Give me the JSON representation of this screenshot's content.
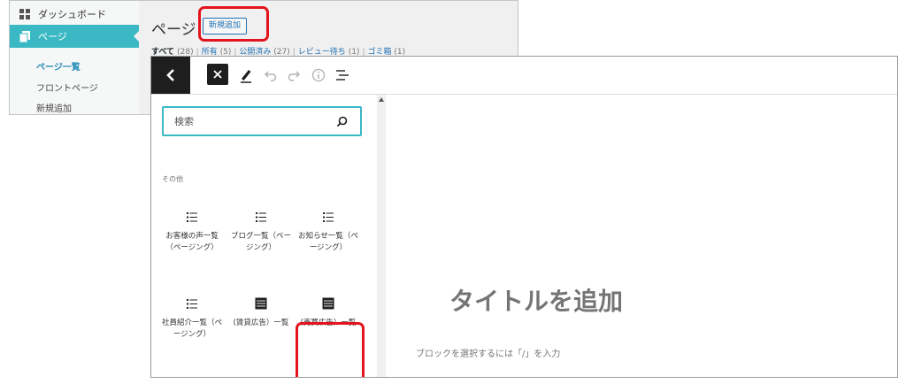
{
  "admin": {
    "sidebar": {
      "dashboard_label": "ダッシュボード",
      "pages_label": "ページ",
      "subitems": [
        "ページ一覧",
        "フロントページ",
        "新規追加"
      ]
    },
    "heading": "ページ",
    "new_button": "新規追加",
    "status": {
      "all": "すべて",
      "all_count": "(28)",
      "owned": "所有",
      "owned_count": "(5)",
      "published": "公開済み",
      "published_count": "(27)",
      "pending": "レビュー待ち",
      "pending_count": "(1)",
      "trash": "ゴミ箱",
      "trash_count": "(1)"
    }
  },
  "editor": {
    "toolbar_icons": [
      "chevron-left-icon",
      "close-icon",
      "pencil-icon",
      "undo-icon",
      "redo-icon",
      "info-icon",
      "list-view-icon"
    ],
    "search": {
      "placeholder": "検索",
      "value": ""
    },
    "category": "その他",
    "blocks": [
      {
        "label": "お客様の声一覧（ページング）",
        "icon": "list-icon"
      },
      {
        "label": "ブログ一覧（ページング）",
        "icon": "list-icon"
      },
      {
        "label": "お知らせ一覧（ページング）",
        "icon": "list-icon"
      },
      {
        "label": "社員紹介一覧（ページング）",
        "icon": "list-icon"
      },
      {
        "label": "(賃貸広告）一覧",
        "icon": "table-icon"
      },
      {
        "label": "(売買広告）一覧",
        "icon": "table-icon"
      }
    ],
    "title_placeholder": "タイトルを追加",
    "block_prompt": "ブロックを選択するには「/」を入力"
  },
  "colors": {
    "accent": "#3ab8c4",
    "highlight": "#e3141d",
    "toolbar_dark": "#1e1e1e",
    "link": "#2271b1"
  }
}
